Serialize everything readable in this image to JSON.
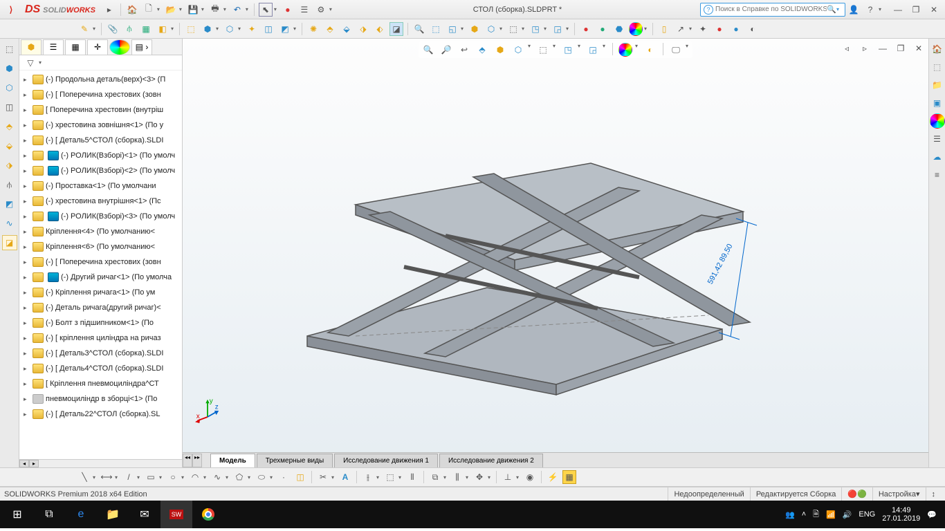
{
  "title": "СТОЛ (сборка).SLDPRT *",
  "logo": {
    "brand1": "SOLID",
    "brand2": "WORKS"
  },
  "search": {
    "placeholder": "Поиск в Справке по SOLIDWORKS"
  },
  "tree": {
    "items": [
      {
        "label": "(-) Продольна деталь(верх)<3> (П",
        "t": "y"
      },
      {
        "label": "(-) [ Поперечина хрестових (зовн",
        "t": "y"
      },
      {
        "label": "[ Поперечина хрестовин (внутріш",
        "t": "y"
      },
      {
        "label": "(-) хрестовина зовнішня<1> (По у",
        "t": "y"
      },
      {
        "label": "(-) [ Деталь5^СТОЛ (сборка).SLDI",
        "t": "y"
      },
      {
        "label": "(-) РОЛИК(Взборі)<1> (По умолч",
        "t": "b"
      },
      {
        "label": "(-) РОЛИК(Взборі)<2> (По умолч",
        "t": "b"
      },
      {
        "label": "(-) Проставка<1> (По умолчани",
        "t": "y"
      },
      {
        "label": "(-) хрестовина внутрішня<1> (Пс",
        "t": "y"
      },
      {
        "label": "(-) РОЛИК(Взборі)<3> (По умолч",
        "t": "b"
      },
      {
        "label": "Кріплення<4> (По умолчанию<",
        "t": "y"
      },
      {
        "label": "Кріплення<6> (По умолчанию<",
        "t": "y"
      },
      {
        "label": "(-) [ Поперечина хрестових (зовн",
        "t": "y"
      },
      {
        "label": "(-) Другий ричаг<1> (По умолча",
        "t": "b"
      },
      {
        "label": "(-) Кріплення ричага<1> (По ум",
        "t": "y"
      },
      {
        "label": "(-) Деталь ричага(другий ричаг)<",
        "t": "y"
      },
      {
        "label": "(-) Болт з підшипником<1> (По",
        "t": "y"
      },
      {
        "label": "(-) [ кріплення циліндра на ричаз",
        "t": "y"
      },
      {
        "label": "(-) [ Деталь3^СТОЛ (сборка).SLDI",
        "t": "y"
      },
      {
        "label": "(-) [ Деталь4^СТОЛ (сборка).SLDI",
        "t": "y"
      },
      {
        "label": "[ Кріплення пневмоциліндра^СТ",
        "t": "y"
      },
      {
        "label": "пневмоциліндр в зборці<1> (По",
        "t": "g"
      },
      {
        "label": "(-) [ Деталь22^СТОЛ (сборка).SL",
        "t": "y"
      }
    ]
  },
  "bottomTabs": {
    "t0": "Модель",
    "t1": "Трехмерные виды",
    "t2": "Исследование движения 1",
    "t3": "Исследование движения 2"
  },
  "status": {
    "edition": "SOLIDWORKS Premium 2018 x64 Edition",
    "underdefined": "Недоопределенный",
    "editing": "Редактируется Сборка",
    "custom": "Настройка"
  },
  "dimension": "591,42 89,50",
  "triad": {
    "x": "x",
    "y": "y",
    "z": "z"
  },
  "tray": {
    "lang": "ENG",
    "time": "14:49",
    "date": "27.01.2019"
  }
}
